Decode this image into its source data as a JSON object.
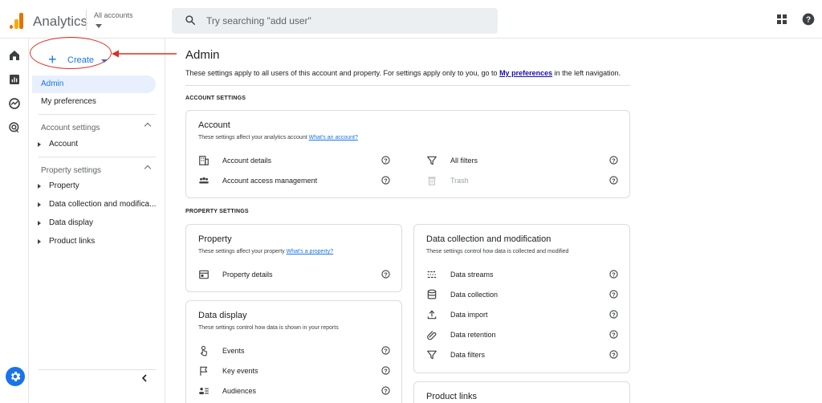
{
  "header": {
    "app_title": "Analytics",
    "account_selector": "All accounts",
    "search_placeholder": "Try searching \"add user\""
  },
  "sidebar": {
    "create_label": "Create",
    "nav": [
      "Admin",
      "My preferences"
    ],
    "account_settings": {
      "heading": "Account settings",
      "items": [
        "Account"
      ]
    },
    "property_settings": {
      "heading": "Property settings",
      "items": [
        "Property",
        "Data collection and modifica...",
        "Data display",
        "Product links"
      ]
    }
  },
  "main": {
    "title": "Admin",
    "desc_prefix": "These settings apply to all users of this account and property. For settings apply only to you, go to ",
    "desc_link": "My preferences",
    "desc_suffix": " in the left navigation.",
    "account_section_label": "ACCOUNT SETTINGS",
    "property_section_label": "PROPERTY SETTINGS",
    "account_card": {
      "title": "Account",
      "desc": "These settings affect your analytics account ",
      "link": "What's an account?",
      "rows": [
        "Account details",
        "Account access management"
      ],
      "rows_right": [
        "All filters",
        "Trash"
      ]
    },
    "property_card": {
      "title": "Property",
      "desc": "These settings affect your property ",
      "link": "What's a property?",
      "rows": [
        "Property details"
      ]
    },
    "data_display_card": {
      "title": "Data display",
      "desc": "These settings control how data is shown in your reports",
      "rows": [
        "Events",
        "Key events",
        "Audiences"
      ]
    },
    "data_collection_card": {
      "title": "Data collection and modification",
      "desc": "These settings control how data is collected and modified",
      "rows": [
        "Data streams",
        "Data collection",
        "Data import",
        "Data retention",
        "Data filters"
      ]
    },
    "product_links_card": {
      "title": "Product links"
    }
  },
  "colors": {
    "accent": "#1a73e8",
    "annotation": "#d93025",
    "active_bg": "#e8f0fe"
  }
}
